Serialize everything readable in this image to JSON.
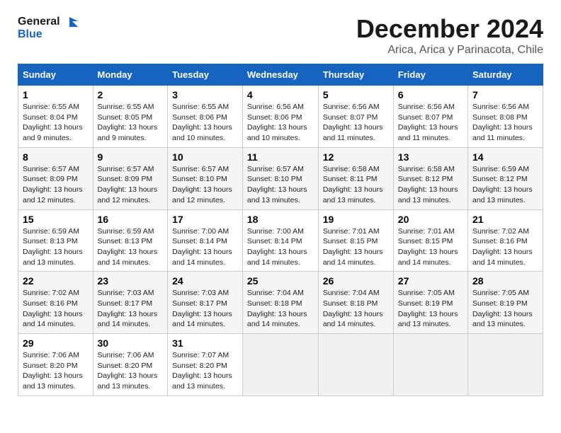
{
  "header": {
    "logo_line1": "General",
    "logo_line2": "Blue",
    "month_title": "December 2024",
    "location": "Arica, Arica y Parinacota, Chile"
  },
  "days_of_week": [
    "Sunday",
    "Monday",
    "Tuesday",
    "Wednesday",
    "Thursday",
    "Friday",
    "Saturday"
  ],
  "weeks": [
    [
      {
        "day": "1",
        "sunrise": "6:55 AM",
        "sunset": "8:04 PM",
        "daylight": "13 hours and 9 minutes."
      },
      {
        "day": "2",
        "sunrise": "6:55 AM",
        "sunset": "8:05 PM",
        "daylight": "13 hours and 9 minutes."
      },
      {
        "day": "3",
        "sunrise": "6:55 AM",
        "sunset": "8:06 PM",
        "daylight": "13 hours and 10 minutes."
      },
      {
        "day": "4",
        "sunrise": "6:56 AM",
        "sunset": "8:06 PM",
        "daylight": "13 hours and 10 minutes."
      },
      {
        "day": "5",
        "sunrise": "6:56 AM",
        "sunset": "8:07 PM",
        "daylight": "13 hours and 11 minutes."
      },
      {
        "day": "6",
        "sunrise": "6:56 AM",
        "sunset": "8:07 PM",
        "daylight": "13 hours and 11 minutes."
      },
      {
        "day": "7",
        "sunrise": "6:56 AM",
        "sunset": "8:08 PM",
        "daylight": "13 hours and 11 minutes."
      }
    ],
    [
      {
        "day": "8",
        "sunrise": "6:57 AM",
        "sunset": "8:09 PM",
        "daylight": "13 hours and 12 minutes."
      },
      {
        "day": "9",
        "sunrise": "6:57 AM",
        "sunset": "8:09 PM",
        "daylight": "13 hours and 12 minutes."
      },
      {
        "day": "10",
        "sunrise": "6:57 AM",
        "sunset": "8:10 PM",
        "daylight": "13 hours and 12 minutes."
      },
      {
        "day": "11",
        "sunrise": "6:57 AM",
        "sunset": "8:10 PM",
        "daylight": "13 hours and 13 minutes."
      },
      {
        "day": "12",
        "sunrise": "6:58 AM",
        "sunset": "8:11 PM",
        "daylight": "13 hours and 13 minutes."
      },
      {
        "day": "13",
        "sunrise": "6:58 AM",
        "sunset": "8:12 PM",
        "daylight": "13 hours and 13 minutes."
      },
      {
        "day": "14",
        "sunrise": "6:59 AM",
        "sunset": "8:12 PM",
        "daylight": "13 hours and 13 minutes."
      }
    ],
    [
      {
        "day": "15",
        "sunrise": "6:59 AM",
        "sunset": "8:13 PM",
        "daylight": "13 hours and 13 minutes."
      },
      {
        "day": "16",
        "sunrise": "6:59 AM",
        "sunset": "8:13 PM",
        "daylight": "13 hours and 14 minutes."
      },
      {
        "day": "17",
        "sunrise": "7:00 AM",
        "sunset": "8:14 PM",
        "daylight": "13 hours and 14 minutes."
      },
      {
        "day": "18",
        "sunrise": "7:00 AM",
        "sunset": "8:14 PM",
        "daylight": "13 hours and 14 minutes."
      },
      {
        "day": "19",
        "sunrise": "7:01 AM",
        "sunset": "8:15 PM",
        "daylight": "13 hours and 14 minutes."
      },
      {
        "day": "20",
        "sunrise": "7:01 AM",
        "sunset": "8:15 PM",
        "daylight": "13 hours and 14 minutes."
      },
      {
        "day": "21",
        "sunrise": "7:02 AM",
        "sunset": "8:16 PM",
        "daylight": "13 hours and 14 minutes."
      }
    ],
    [
      {
        "day": "22",
        "sunrise": "7:02 AM",
        "sunset": "8:16 PM",
        "daylight": "13 hours and 14 minutes."
      },
      {
        "day": "23",
        "sunrise": "7:03 AM",
        "sunset": "8:17 PM",
        "daylight": "13 hours and 14 minutes."
      },
      {
        "day": "24",
        "sunrise": "7:03 AM",
        "sunset": "8:17 PM",
        "daylight": "13 hours and 14 minutes."
      },
      {
        "day": "25",
        "sunrise": "7:04 AM",
        "sunset": "8:18 PM",
        "daylight": "13 hours and 14 minutes."
      },
      {
        "day": "26",
        "sunrise": "7:04 AM",
        "sunset": "8:18 PM",
        "daylight": "13 hours and 14 minutes."
      },
      {
        "day": "27",
        "sunrise": "7:05 AM",
        "sunset": "8:19 PM",
        "daylight": "13 hours and 13 minutes."
      },
      {
        "day": "28",
        "sunrise": "7:05 AM",
        "sunset": "8:19 PM",
        "daylight": "13 hours and 13 minutes."
      }
    ],
    [
      {
        "day": "29",
        "sunrise": "7:06 AM",
        "sunset": "8:20 PM",
        "daylight": "13 hours and 13 minutes."
      },
      {
        "day": "30",
        "sunrise": "7:06 AM",
        "sunset": "8:20 PM",
        "daylight": "13 hours and 13 minutes."
      },
      {
        "day": "31",
        "sunrise": "7:07 AM",
        "sunset": "8:20 PM",
        "daylight": "13 hours and 13 minutes."
      },
      null,
      null,
      null,
      null
    ]
  ],
  "labels": {
    "sunrise": "Sunrise:",
    "sunset": "Sunset:",
    "daylight": "Daylight:"
  }
}
